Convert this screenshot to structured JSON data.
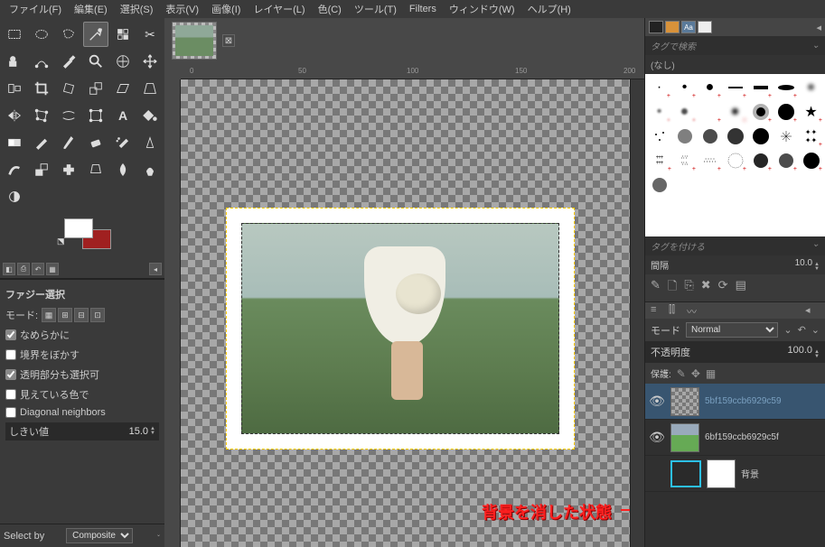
{
  "menu": {
    "file": "ファイル(F)",
    "edit": "編集(E)",
    "select": "選択(S)",
    "view": "表示(V)",
    "image": "画像(I)",
    "layer": "レイヤー(L)",
    "colors": "色(C)",
    "tools": "ツール(T)",
    "filters": "Filters",
    "windows": "ウィンドウ(W)",
    "help": "ヘルプ(H)"
  },
  "tool_options": {
    "title": "ファジー選択",
    "mode_label": "モード:",
    "antialias": "なめらかに",
    "feather": "境界をぼかす",
    "transparent": "透明部分も選択可",
    "sample_merged": "見えている色で",
    "diagonal": "Diagonal neighbors",
    "threshold_label": "しきい値",
    "threshold_value": "15.0",
    "select_by_label": "Select by",
    "select_by_value": "Composite"
  },
  "ruler": {
    "t0": "0",
    "t50": "50",
    "t100": "100",
    "t150": "150",
    "t200": "200"
  },
  "annotation": "背景を消した状態",
  "right": {
    "search_placeholder": "タグで検索",
    "none": "(なし)",
    "tag_placeholder": "タグを付ける",
    "spacing_label": "間隔",
    "spacing_value": "10.0",
    "aa": "Aa"
  },
  "layers": {
    "mode_label": "モード",
    "mode_value": "Normal",
    "opacity_label": "不透明度",
    "opacity_value": "100.0",
    "lock_label": "保護:",
    "layer1": "5bf159ccb6929c59",
    "layer2": "6bf159ccb6929c5f",
    "layer3": "背景"
  },
  "chart_data": null
}
